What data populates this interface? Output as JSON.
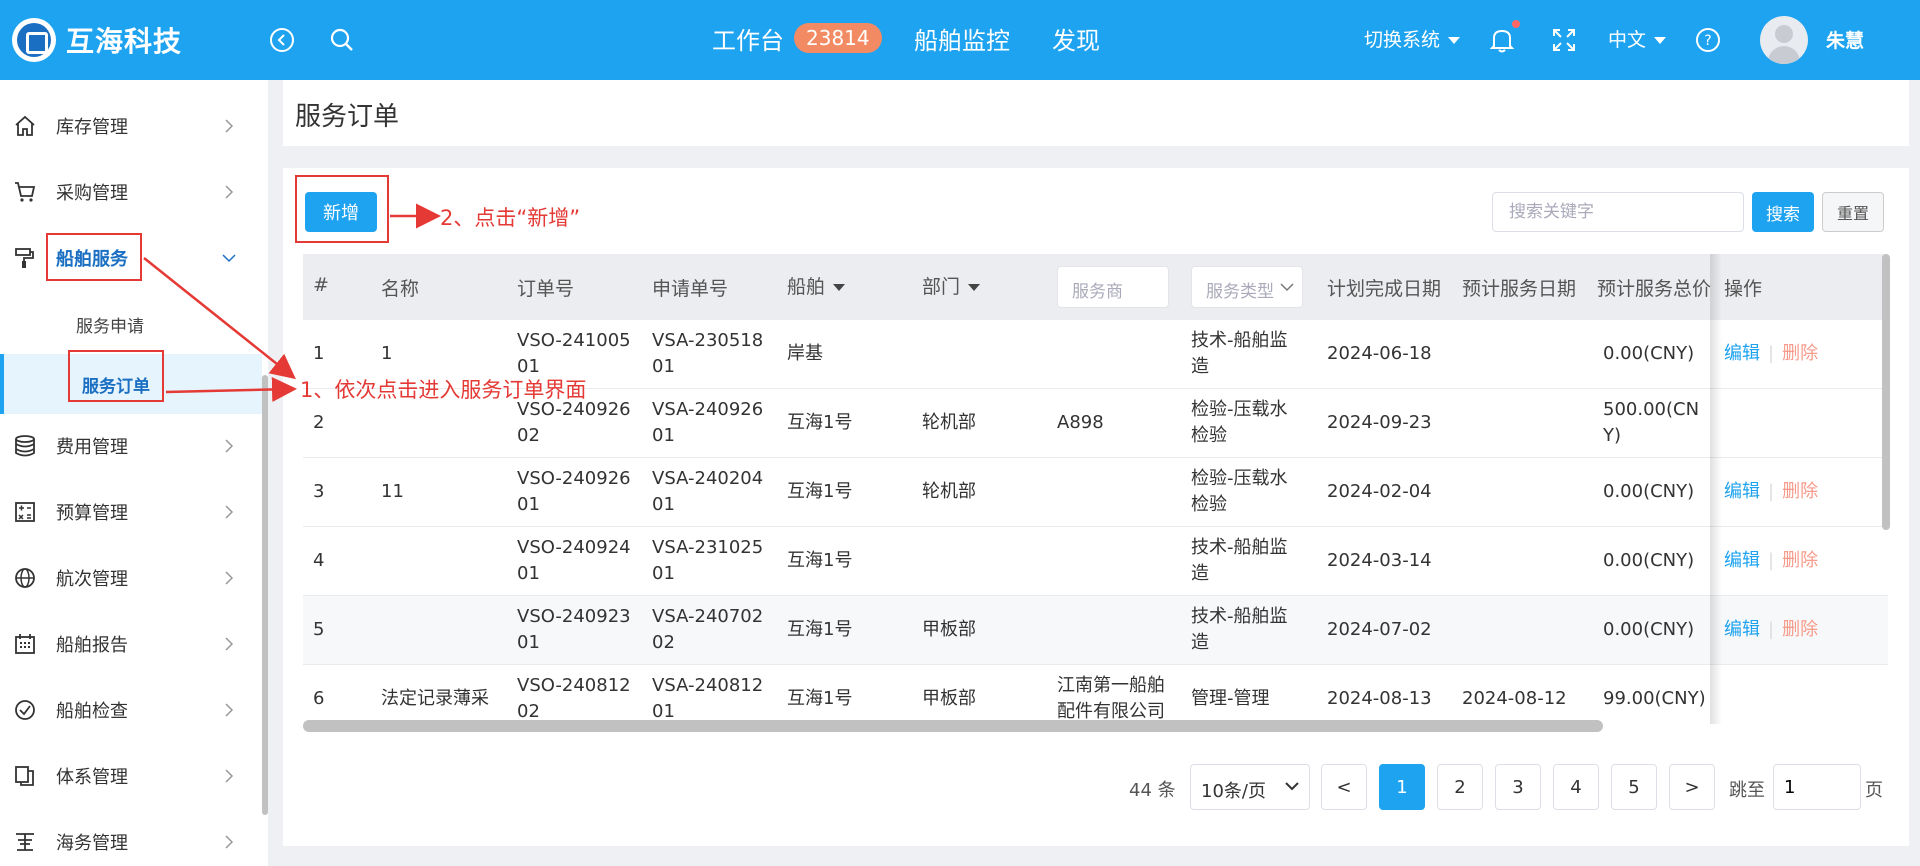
{
  "header": {
    "brand": "互海科技",
    "nav": [
      "工作台",
      "船舶监控",
      "发现"
    ],
    "badge": "23814",
    "switch_system": "切换系统",
    "language": "中文",
    "username": "朱慧"
  },
  "sidebar": {
    "items": [
      {
        "label": "库存管理",
        "icon": "home-icon"
      },
      {
        "label": "采购管理",
        "icon": "cart-icon"
      },
      {
        "label": "船舶服务",
        "icon": "paint-roller-icon"
      },
      {
        "label": "费用管理",
        "icon": "database-icon"
      },
      {
        "label": "预算管理",
        "icon": "calculator-icon"
      },
      {
        "label": "航次管理",
        "icon": "globe-icon"
      },
      {
        "label": "船舶报告",
        "icon": "calendar-icon"
      },
      {
        "label": "船舶检查",
        "icon": "check-circle-icon"
      },
      {
        "label": "体系管理",
        "icon": "documents-icon"
      },
      {
        "label": "海务管理",
        "icon": "anchor-icon"
      }
    ],
    "sub_items": [
      "服务申请",
      "服务订单"
    ]
  },
  "page": {
    "title": "服务订单"
  },
  "toolbar": {
    "new_label": "新增",
    "search_placeholder": "搜索关键字",
    "search_label": "搜索",
    "reset_label": "重置"
  },
  "table": {
    "headers": {
      "index": "#",
      "name": "名称",
      "order_no": "订单号",
      "request_no": "申请单号",
      "ship": "船舶",
      "department": "部门",
      "provider": "服务商",
      "service_type": "服务类型",
      "plan_date": "计划完成日期",
      "expected_date": "预计服务日期",
      "total": "预计服务总价",
      "actions": "操作"
    },
    "rows": [
      {
        "index": "1",
        "name": "1",
        "order_no": [
          "VSO-241005",
          "01"
        ],
        "request_no": [
          "VSA-230518",
          "01"
        ],
        "ship": "岸基",
        "department": "",
        "provider": [],
        "service_type": [
          "技术-船舶监",
          "造"
        ],
        "plan_date": "2024-06-18",
        "expected_date": "",
        "total": [
          "0.00(CNY)"
        ],
        "edit": "编辑",
        "delete": "删除"
      },
      {
        "index": "2",
        "name": "",
        "order_no": [
          "VSO-240926",
          "02"
        ],
        "request_no": [
          "VSA-240926",
          "01"
        ],
        "ship": "互海1号",
        "department": "轮机部",
        "provider": [
          "A898"
        ],
        "service_type": [
          "检验-压载水",
          "检验"
        ],
        "plan_date": "2024-09-23",
        "expected_date": "",
        "total": [
          "500.00(CN",
          "Y)"
        ],
        "edit": "",
        "delete": ""
      },
      {
        "index": "3",
        "name": "11",
        "order_no": [
          "VSO-240926",
          "01"
        ],
        "request_no": [
          "VSA-240204",
          "01"
        ],
        "ship": "互海1号",
        "department": "轮机部",
        "provider": [],
        "service_type": [
          "检验-压载水",
          "检验"
        ],
        "plan_date": "2024-02-04",
        "expected_date": "",
        "total": [
          "0.00(CNY)"
        ],
        "edit": "编辑",
        "delete": "删除"
      },
      {
        "index": "4",
        "name": "",
        "order_no": [
          "VSO-240924",
          "01"
        ],
        "request_no": [
          "VSA-231025",
          "01"
        ],
        "ship": "互海1号",
        "department": "",
        "provider": [],
        "service_type": [
          "技术-船舶监",
          "造"
        ],
        "plan_date": "2024-03-14",
        "expected_date": "",
        "total": [
          "0.00(CNY)"
        ],
        "edit": "编辑",
        "delete": "删除"
      },
      {
        "index": "5",
        "name": "",
        "order_no": [
          "VSO-240923",
          "01"
        ],
        "request_no": [
          "VSA-240702",
          "02"
        ],
        "ship": "互海1号",
        "department": "甲板部",
        "provider": [],
        "service_type": [
          "技术-船舶监",
          "造"
        ],
        "plan_date": "2024-07-02",
        "expected_date": "",
        "total": [
          "0.00(CNY)"
        ],
        "edit": "编辑",
        "delete": "删除"
      },
      {
        "index": "6",
        "name": "法定记录薄采",
        "order_no": [
          "VSO-240812",
          "02"
        ],
        "request_no": [
          "VSA-240812",
          "01"
        ],
        "ship": "互海1号",
        "department": "甲板部",
        "provider": [
          "江南第一船舶",
          "配件有限公司"
        ],
        "service_type": [
          "管理-管理"
        ],
        "plan_date": "2024-08-13",
        "expected_date": "2024-08-12",
        "total": [
          "99.00(CNY)"
        ],
        "edit": "",
        "delete": ""
      }
    ]
  },
  "pagination": {
    "total": "44 条",
    "page_size": "10条/页",
    "pages": [
      "1",
      "2",
      "3",
      "4",
      "5"
    ],
    "prev": "<",
    "next": ">",
    "jump_label": "跳至",
    "jump_value": "1",
    "page_suffix": "页"
  },
  "annotations": {
    "step1": "1、依次点击进入服务订单界面",
    "step2": "2、点击“新增”"
  }
}
